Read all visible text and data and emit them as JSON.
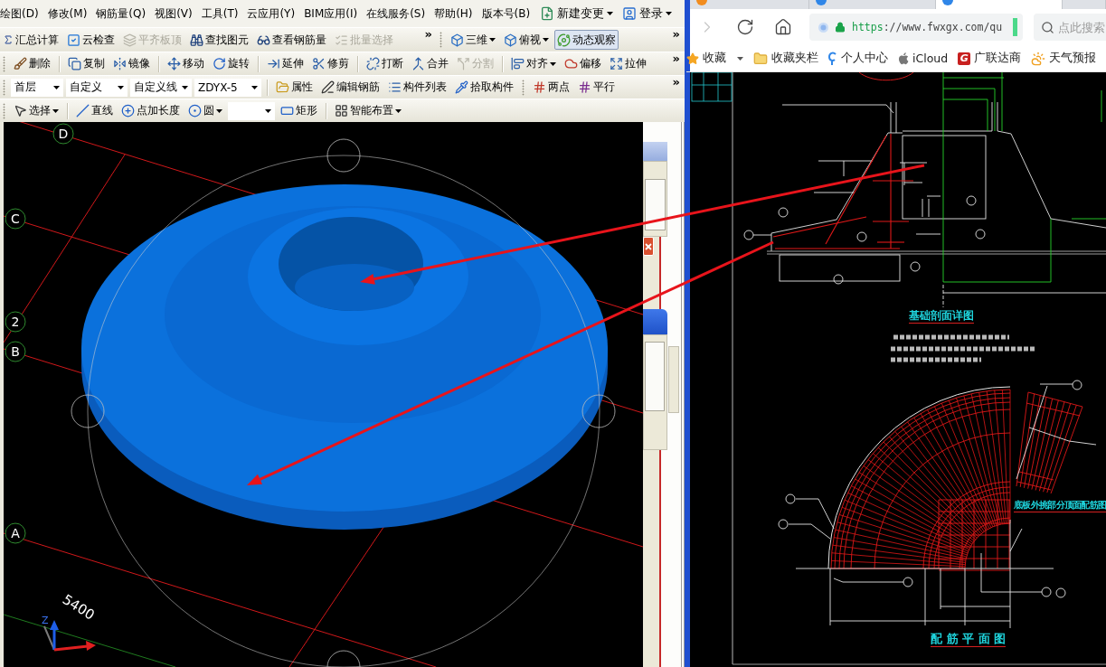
{
  "app": {
    "menu_bar": {
      "menus": [
        "绘图(D)",
        "修改(M)",
        "钢筋量(Q)",
        "视图(V)",
        "工具(T)",
        "云应用(Y)",
        "BIM应用(I)",
        "在线服务(S)",
        "帮助(H)",
        "版本号(B)"
      ],
      "actions": [
        {
          "label": "新建变更"
        },
        {
          "label": "登录"
        }
      ]
    },
    "toolbar_rows": [
      {
        "toolbars": [
          {
            "groups": [
              {
                "items": [
                  {
                    "kind": "button",
                    "label": "汇总计算",
                    "disabled": false
                  },
                  {
                    "kind": "button",
                    "label": "云检查",
                    "disabled": false
                  },
                  {
                    "kind": "button",
                    "label": "平齐板顶",
                    "disabled": true
                  },
                  {
                    "kind": "button",
                    "label": "查找图元",
                    "disabled": false
                  },
                  {
                    "kind": "button",
                    "label": "查看钢筋量",
                    "disabled": false
                  },
                  {
                    "kind": "button",
                    "label": "批量选择",
                    "disabled": true
                  }
                ]
              }
            ],
            "overflow": "»"
          },
          {
            "groups": [
              {
                "items": [
                  {
                    "kind": "menu_button",
                    "label": "三维",
                    "disabled": false,
                    "pressed": false
                  },
                  {
                    "kind": "menu_button",
                    "label": "俯视",
                    "disabled": false,
                    "pressed": false
                  },
                  {
                    "kind": "button",
                    "label": "动态观察",
                    "disabled": false,
                    "pressed": true
                  }
                ]
              }
            ],
            "overflow": "»"
          }
        ]
      },
      {
        "toolbars": [
          {
            "groups": [
              {
                "items": [
                  {
                    "kind": "button",
                    "label": "删除",
                    "disabled": false
                  }
                ]
              },
              {
                "items": [
                  {
                    "kind": "button",
                    "label": "复制",
                    "disabled": false
                  },
                  {
                    "kind": "button",
                    "label": "镜像",
                    "disabled": false
                  }
                ]
              },
              {
                "items": [
                  {
                    "kind": "button",
                    "label": "移动",
                    "disabled": false
                  },
                  {
                    "kind": "button",
                    "label": "旋转",
                    "disabled": false
                  }
                ]
              },
              {
                "items": [
                  {
                    "kind": "button",
                    "label": "延伸",
                    "disabled": false
                  },
                  {
                    "kind": "button",
                    "label": "修剪",
                    "disabled": false
                  }
                ]
              },
              {
                "items": [
                  {
                    "kind": "button",
                    "label": "打断",
                    "disabled": false
                  },
                  {
                    "kind": "button",
                    "label": "合并",
                    "disabled": false
                  },
                  {
                    "kind": "button",
                    "label": "分割",
                    "disabled": true
                  }
                ]
              },
              {
                "items": [
                  {
                    "kind": "menu_button",
                    "label": "对齐",
                    "disabled": false
                  },
                  {
                    "kind": "button",
                    "label": "偏移",
                    "disabled": false
                  },
                  {
                    "kind": "button",
                    "label": "拉伸",
                    "disabled": false
                  }
                ]
              }
            ],
            "overflow": "»"
          }
        ]
      },
      {
        "toolbars": [
          {
            "groups": [
              {
                "items": [
                  {
                    "kind": "combo",
                    "value": "首层"
                  },
                  {
                    "kind": "combo",
                    "value": "自定义"
                  },
                  {
                    "kind": "combo",
                    "value": "自定义线"
                  },
                  {
                    "kind": "combo",
                    "value": "ZDYX-5"
                  }
                ]
              },
              {
                "items": [
                  {
                    "kind": "button",
                    "label": "属性",
                    "disabled": false
                  },
                  {
                    "kind": "button",
                    "label": "编辑钢筋",
                    "disabled": false
                  },
                  {
                    "kind": "button",
                    "label": "构件列表",
                    "disabled": false
                  },
                  {
                    "kind": "button",
                    "label": "拾取构件",
                    "disabled": false
                  }
                ]
              }
            ]
          },
          {
            "groups": [
              {
                "items": [
                  {
                    "kind": "button",
                    "label": "两点",
                    "disabled": false
                  },
                  {
                    "kind": "button",
                    "label": "平行",
                    "disabled": false
                  }
                ]
              }
            ],
            "overflow": "»"
          }
        ]
      },
      {
        "toolbars": [
          {
            "groups": [
              {
                "items": [
                  {
                    "kind": "menu_button",
                    "label": "选择",
                    "disabled": false
                  }
                ]
              },
              {
                "items": [
                  {
                    "kind": "button",
                    "label": "直线",
                    "disabled": false
                  },
                  {
                    "kind": "button",
                    "label": "点加长度",
                    "disabled": false
                  },
                  {
                    "kind": "menu_button",
                    "label": "圆",
                    "disabled": false
                  },
                  {
                    "kind": "combo"
                  },
                  {
                    "kind": "button",
                    "label": "矩形",
                    "disabled": false
                  }
                ]
              },
              {
                "items": [
                  {
                    "kind": "menu_button",
                    "label": "智能布置",
                    "disabled": false
                  }
                ]
              }
            ]
          }
        ]
      }
    ],
    "viewport": {
      "axis_labels": [
        "D",
        "C",
        "2",
        "B",
        "A"
      ],
      "dimension": "5400",
      "axis_letter": "Z"
    }
  },
  "browser": {
    "tabs": [
      {
        "selected": false
      },
      {
        "selected": false
      },
      {
        "selected": true
      },
      {
        "selected": false
      }
    ],
    "nav_buttons": [
      {
        "kind": "forward",
        "disabled": true
      },
      {
        "kind": "reload",
        "disabled": false
      },
      {
        "kind": "home",
        "disabled": false
      }
    ],
    "address": {
      "scheme": "https",
      "rest": "://www.fwxgx.com/qu"
    },
    "search": {
      "placeholder": "点此搜索"
    },
    "bookmarks": [
      {
        "kind": "menu",
        "label": "收藏"
      },
      {
        "kind": "folder",
        "label": "收藏夹栏"
      },
      {
        "kind": "link",
        "label": "个人中心"
      },
      {
        "kind": "link",
        "label": "iCloud"
      },
      {
        "kind": "link",
        "label": "广联达商",
        "logo_text": "G"
      },
      {
        "kind": "link",
        "label": "天气预报"
      }
    ],
    "drawing": {
      "section_title": "基础剖面详图",
      "detail_title": "底板外挑部分顶面配筋图",
      "plan_title": "配 筋 平 面 图"
    }
  }
}
